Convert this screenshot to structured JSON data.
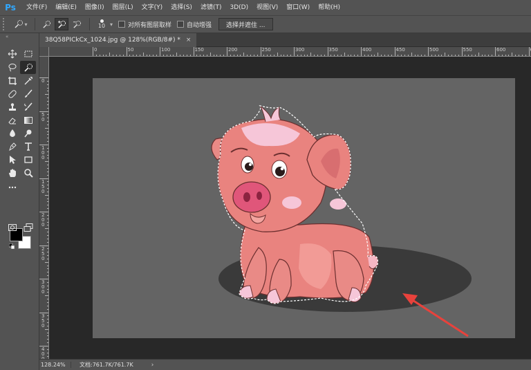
{
  "app": {
    "logo": "Ps"
  },
  "menu": [
    "文件(F)",
    "编辑(E)",
    "图像(I)",
    "图层(L)",
    "文字(Y)",
    "选择(S)",
    "滤镜(T)",
    "3D(D)",
    "视图(V)",
    "窗口(W)",
    "帮助(H)"
  ],
  "options": {
    "brush_size": "10",
    "sample_all_layers": "对所有图层取样",
    "auto_enhance": "自动增强",
    "select_and_mask": "选择并遮住 ..."
  },
  "document": {
    "tab_title": "38Q58PICkCx_1024.jpg @ 128%(RGB/8#) *",
    "close_glyph": "×"
  },
  "ruler_h": [
    "0",
    "50",
    "100",
    "150",
    "200",
    "250",
    "300",
    "350",
    "400",
    "450",
    "500",
    "550",
    "600",
    "650"
  ],
  "ruler_v": [
    "0",
    "5 0",
    "1 0 0",
    "1 5 0",
    "2 0 0",
    "2 5 0",
    "3 0 0",
    "3 5 0",
    "4 0 0"
  ],
  "status": {
    "zoom": "128.24%",
    "doc_info": "文档:761.7K/761.7K",
    "arrow": "›"
  },
  "colors": {
    "foreground": "#000000",
    "background": "#ffffff",
    "canvas": "#646464",
    "arrow": "#e8423c"
  }
}
